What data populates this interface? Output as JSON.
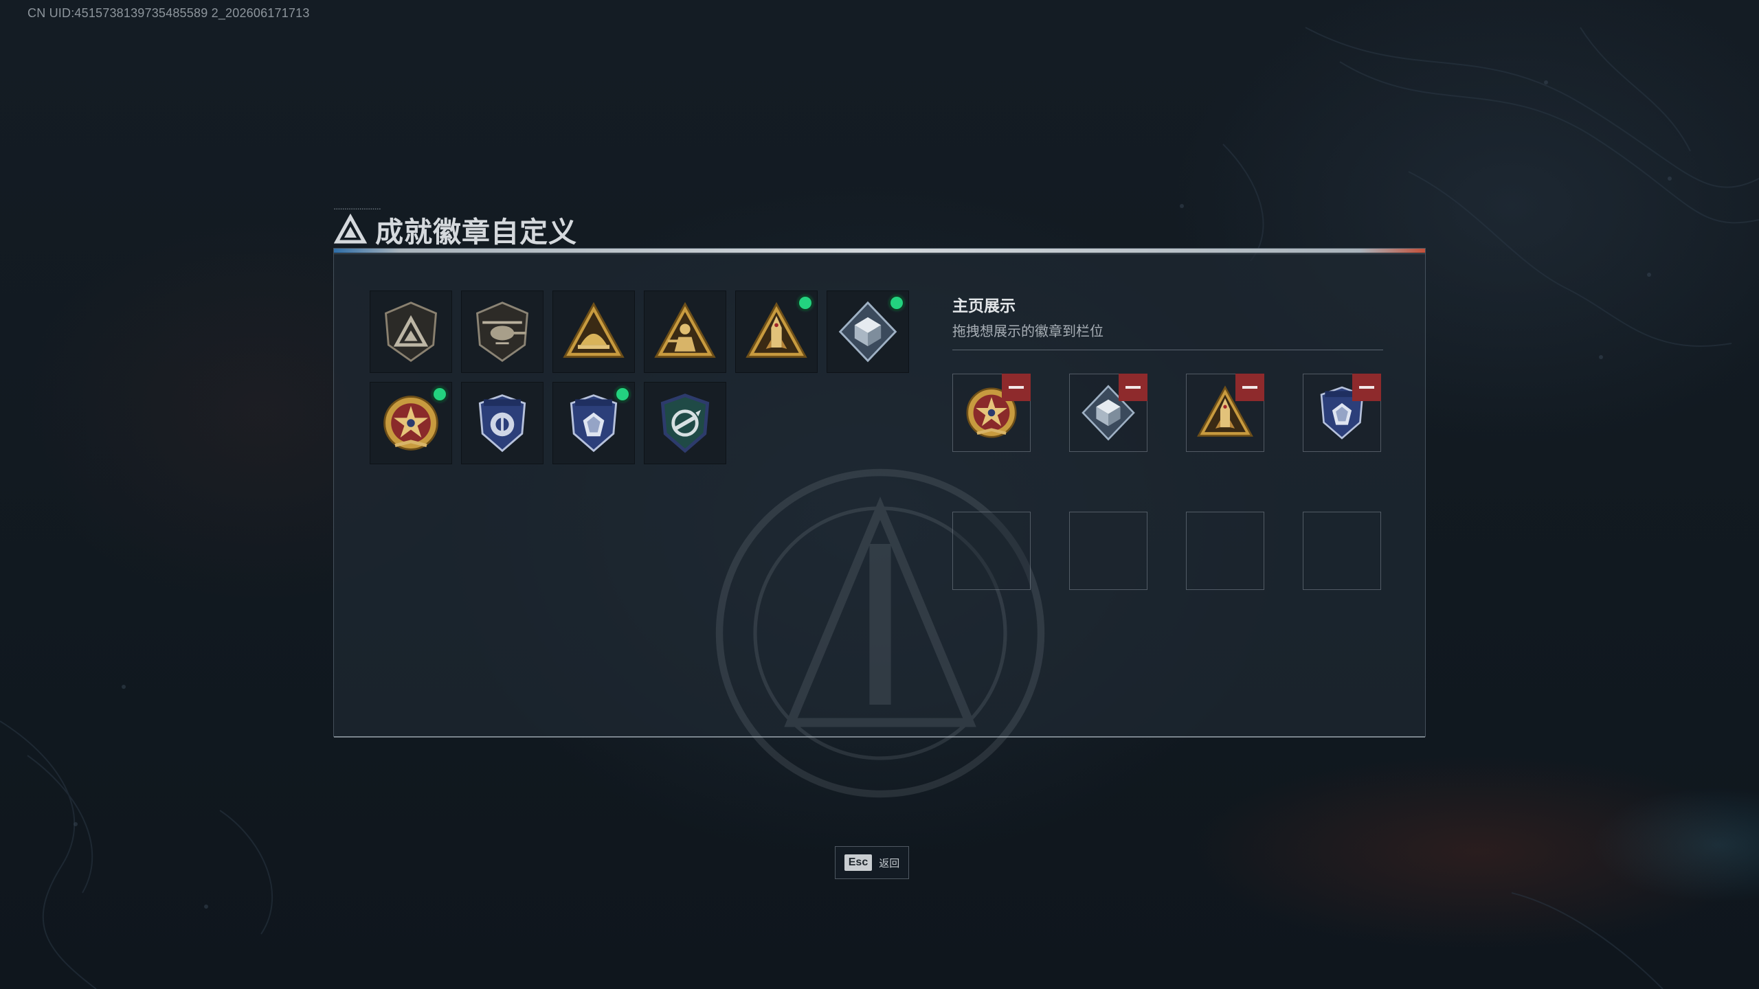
{
  "header": {
    "uid": "CN UID:4515738139735485589 2_202606171713"
  },
  "dialog": {
    "title": "成就徽章自定义",
    "title_icon": "triangle-logo-icon"
  },
  "badges": [
    {
      "name": "shield-triangle-badge",
      "new": false
    },
    {
      "name": "helicopter-badge",
      "new": false
    },
    {
      "name": "gold-helmet-badge",
      "new": false
    },
    {
      "name": "gold-soldier-badge",
      "new": false
    },
    {
      "name": "gold-rocket-badge",
      "new": true
    },
    {
      "name": "diamond-cube-badge",
      "new": true
    },
    {
      "name": "star-medal-badge",
      "new": true
    },
    {
      "name": "blue-shield-badge",
      "new": false
    },
    {
      "name": "blue-gem-shield-badge",
      "new": true
    },
    {
      "name": "crosshair-shield-badge",
      "new": false
    }
  ],
  "showcase": {
    "title": "主页展示",
    "subtitle": "拖拽想展示的徽章到栏位",
    "slots": [
      "star-medal-badge",
      "diamond-cube-badge",
      "gold-rocket-badge",
      "blue-gem-shield-badge",
      "",
      "",
      "",
      ""
    ]
  },
  "footer": {
    "esc_key": "Esc",
    "esc_label": "返回"
  },
  "colors": {
    "new_indicator": "#23d27f",
    "remove_button": "#8e2a2c",
    "accent_bar_left": "#2f6ea8",
    "accent_bar_right": "#c2503a"
  }
}
